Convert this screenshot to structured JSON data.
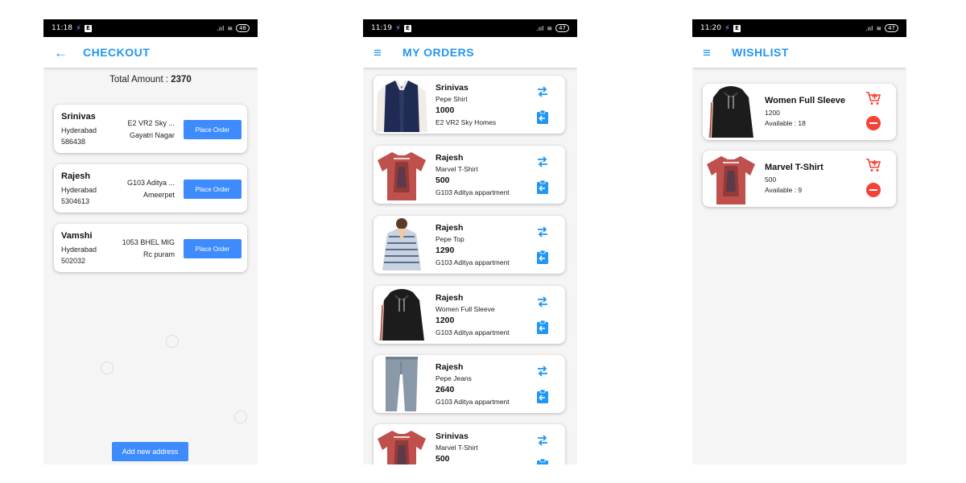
{
  "colors": {
    "accent": "#2196f3",
    "button": "#3d8bfd",
    "danger": "#f44336",
    "cart": "#f44336"
  },
  "screens": [
    {
      "status": {
        "time": "11:18",
        "battery": "48"
      },
      "appbar": {
        "title": "CHECKOUT",
        "nav_icon": "back-arrow-icon"
      },
      "total": {
        "label": "Total Amount : ",
        "value": "2370"
      },
      "addresses": [
        {
          "name": "Srinivas",
          "city": "Hyderabad",
          "pin": "586438",
          "line1": "E2 VR2 Sky ...",
          "line2": "Gayatri Nagar",
          "button": "Place Order"
        },
        {
          "name": "Rajesh",
          "city": "Hyderabad",
          "pin": "5304613",
          "line1": "G103 Aditya ...",
          "line2": "Ameerpet",
          "button": "Place Order"
        },
        {
          "name": "Vamshi",
          "city": "Hyderabad",
          "pin": "502032",
          "line1": "1053 BHEL MIG",
          "line2": "Rc puram",
          "button": "Place Order"
        }
      ],
      "add_address_label": "Add new address"
    },
    {
      "status": {
        "time": "11:19",
        "battery": "47"
      },
      "appbar": {
        "title": "MY ORDERS",
        "nav_icon": "menu-icon"
      },
      "orders": [
        {
          "name": "Srinivas",
          "product": "Pepe Shirt",
          "price": "1000",
          "address": "E2 VR2 Sky Homes",
          "image": "shirt-image"
        },
        {
          "name": "Rajesh",
          "product": "Marvel T-Shirt",
          "price": "500",
          "address": "G103 Aditya appartment",
          "image": "tshirt-image"
        },
        {
          "name": "Rajesh",
          "product": "Pepe Top",
          "price": "1290",
          "address": "G103 Aditya appartment",
          "image": "top-image"
        },
        {
          "name": "Rajesh",
          "product": "Women Full Sleeve",
          "price": "1200",
          "address": "G103 Aditya appartment",
          "image": "hoodie-image"
        },
        {
          "name": "Rajesh",
          "product": "Pepe Jeans",
          "price": "2640",
          "address": "G103 Aditya appartment",
          "image": "jeans-image"
        },
        {
          "name": "Srinivas",
          "product": "Marvel T-Shirt",
          "price": "500",
          "address": "",
          "image": "tshirt-image"
        }
      ]
    },
    {
      "status": {
        "time": "11:20",
        "battery": "47"
      },
      "appbar": {
        "title": "WISHLIST",
        "nav_icon": "menu-icon"
      },
      "wishlist": [
        {
          "name": "Women Full Sleeve",
          "price": "1200",
          "available": "Available : 18",
          "image": "hoodie-image"
        },
        {
          "name": "Marvel T-Shirt",
          "price": "500",
          "available": "Available : 9",
          "image": "tshirt-image"
        }
      ]
    }
  ]
}
